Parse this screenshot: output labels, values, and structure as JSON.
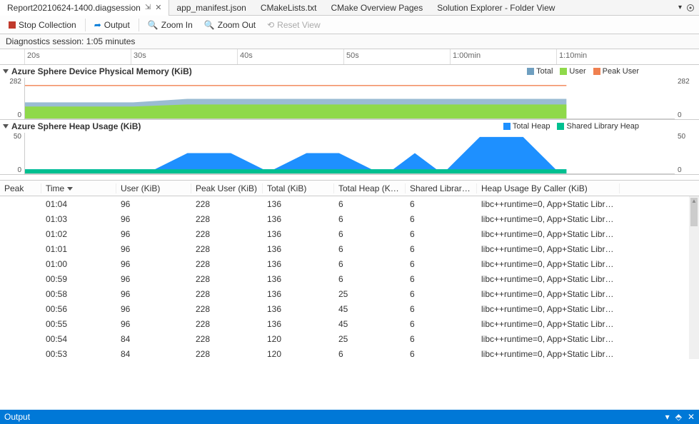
{
  "tabs": {
    "active": "Report20210624-1400.diagsession",
    "others": [
      "app_manifest.json",
      "CMakeLists.txt",
      "CMake Overview Pages",
      "Solution Explorer - Folder View"
    ]
  },
  "toolbar": {
    "stop": "Stop Collection",
    "output": "Output",
    "zoom_in": "Zoom In",
    "zoom_out": "Zoom Out",
    "reset": "Reset View"
  },
  "session_header": "Diagnostics session: 1:05 minutes",
  "timeline_ticks": [
    "20s",
    "30s",
    "40s",
    "50s",
    "1:00min",
    "1:10min"
  ],
  "chart1": {
    "title": "Azure Sphere Device Physical Memory (KiB)",
    "legend": [
      {
        "label": "Total",
        "color": "#6f9fc0"
      },
      {
        "label": "User",
        "color": "#8fd94a"
      },
      {
        "label": "Peak User",
        "color": "#f08050"
      }
    ],
    "ymax": "282",
    "ymin": "0"
  },
  "chart2": {
    "title": "Azure Sphere Heap Usage (KiB)",
    "legend": [
      {
        "label": "Total Heap",
        "color": "#1e90ff"
      },
      {
        "label": "Shared Library Heap",
        "color": "#00c090"
      }
    ],
    "ymax": "50",
    "ymin": "0"
  },
  "chart_data": [
    {
      "type": "area",
      "title": "Azure Sphere Device Physical Memory (KiB)",
      "ylabel": "KiB",
      "ylim": [
        0,
        282
      ],
      "xlim": [
        15,
        75
      ],
      "series": [
        {
          "name": "Peak User",
          "color": "#f08050",
          "style": "line",
          "values": [
            [
              15,
              228
            ],
            [
              65,
              228
            ]
          ]
        },
        {
          "name": "Total",
          "color": "#6f9fc0",
          "style": "area",
          "values": [
            [
              15,
              110
            ],
            [
              25,
              110
            ],
            [
              30,
              136
            ],
            [
              65,
              136
            ]
          ]
        },
        {
          "name": "User",
          "color": "#8fd94a",
          "style": "area",
          "values": [
            [
              15,
              84
            ],
            [
              25,
              84
            ],
            [
              30,
              96
            ],
            [
              65,
              96
            ]
          ]
        }
      ]
    },
    {
      "type": "area",
      "title": "Azure Sphere Heap Usage (KiB)",
      "ylabel": "KiB",
      "ylim": [
        0,
        50
      ],
      "xlim": [
        15,
        75
      ],
      "series": [
        {
          "name": "Total Heap",
          "color": "#1e90ff",
          "style": "area",
          "values": [
            [
              15,
              6
            ],
            [
              27,
              6
            ],
            [
              30,
              25
            ],
            [
              34,
              25
            ],
            [
              37,
              6
            ],
            [
              38,
              6
            ],
            [
              41,
              25
            ],
            [
              44,
              25
            ],
            [
              47,
              6
            ],
            [
              49,
              6
            ],
            [
              51,
              25
            ],
            [
              53,
              6
            ],
            [
              54,
              6
            ],
            [
              57,
              45
            ],
            [
              61,
              45
            ],
            [
              64,
              6
            ],
            [
              65,
              6
            ]
          ]
        },
        {
          "name": "Shared Library Heap",
          "color": "#00c090",
          "style": "area",
          "values": [
            [
              15,
              6
            ],
            [
              65,
              6
            ]
          ]
        }
      ]
    }
  ],
  "table": {
    "columns": [
      "Peak",
      "Time",
      "User (KiB)",
      "Peak User (KiB)",
      "Total (KiB)",
      "Total Heap (KiB)",
      "Shared Library...",
      "Heap Usage By Caller (KiB)"
    ],
    "sort_col": 1,
    "rows": [
      [
        "",
        "01:04",
        "96",
        "228",
        "136",
        "6",
        "6",
        "libc++runtime=0, App+Static Librar..."
      ],
      [
        "",
        "01:03",
        "96",
        "228",
        "136",
        "6",
        "6",
        "libc++runtime=0, App+Static Librar..."
      ],
      [
        "",
        "01:02",
        "96",
        "228",
        "136",
        "6",
        "6",
        "libc++runtime=0, App+Static Librar..."
      ],
      [
        "",
        "01:01",
        "96",
        "228",
        "136",
        "6",
        "6",
        "libc++runtime=0, App+Static Librar..."
      ],
      [
        "",
        "01:00",
        "96",
        "228",
        "136",
        "6",
        "6",
        "libc++runtime=0, App+Static Librar..."
      ],
      [
        "",
        "00:59",
        "96",
        "228",
        "136",
        "6",
        "6",
        "libc++runtime=0, App+Static Librar..."
      ],
      [
        "",
        "00:58",
        "96",
        "228",
        "136",
        "25",
        "6",
        "libc++runtime=0, App+Static Librar..."
      ],
      [
        "",
        "00:56",
        "96",
        "228",
        "136",
        "45",
        "6",
        "libc++runtime=0, App+Static Librar..."
      ],
      [
        "",
        "00:55",
        "96",
        "228",
        "136",
        "45",
        "6",
        "libc++runtime=0, App+Static Librar..."
      ],
      [
        "",
        "00:54",
        "84",
        "228",
        "120",
        "25",
        "6",
        "libc++runtime=0, App+Static Librar..."
      ],
      [
        "",
        "00:53",
        "84",
        "228",
        "120",
        "6",
        "6",
        "libc++runtime=0, App+Static Librar..."
      ]
    ]
  },
  "output_panel": "Output"
}
